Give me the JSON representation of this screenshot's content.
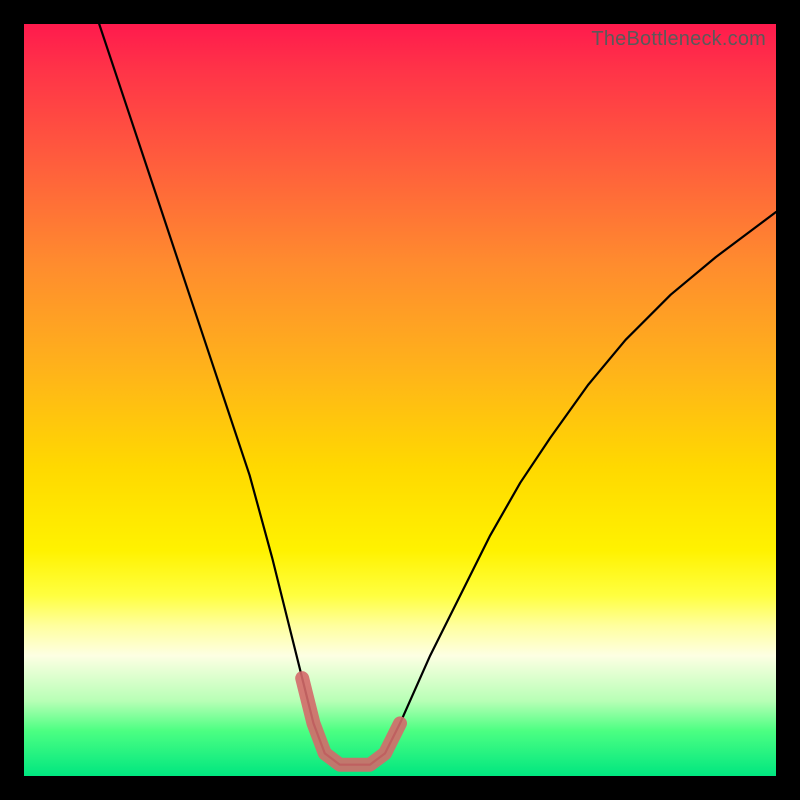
{
  "watermark": "TheBottleneck.com",
  "chart_data": {
    "type": "line",
    "title": "",
    "xlabel": "",
    "ylabel": "",
    "xlim": [
      0,
      100
    ],
    "ylim": [
      0,
      100
    ],
    "series": [
      {
        "name": "curve",
        "x": [
          10,
          14,
          18,
          22,
          26,
          30,
          33,
          35,
          37,
          38.5,
          40,
          42,
          44,
          46,
          48,
          50,
          54,
          58,
          62,
          66,
          70,
          75,
          80,
          86,
          92,
          100
        ],
        "y": [
          100,
          88,
          76,
          64,
          52,
          40,
          29,
          21,
          13,
          7,
          3,
          1.5,
          1.5,
          1.5,
          3,
          7,
          16,
          24,
          32,
          39,
          45,
          52,
          58,
          64,
          69,
          75
        ]
      },
      {
        "name": "valley-highlight",
        "x": [
          37,
          38.5,
          40,
          42,
          44,
          46,
          48,
          50
        ],
        "y": [
          13,
          7,
          3,
          1.5,
          1.5,
          1.5,
          3,
          7
        ]
      }
    ],
    "colors": {
      "curve": "#000000",
      "highlight": "#d46a6a"
    }
  }
}
